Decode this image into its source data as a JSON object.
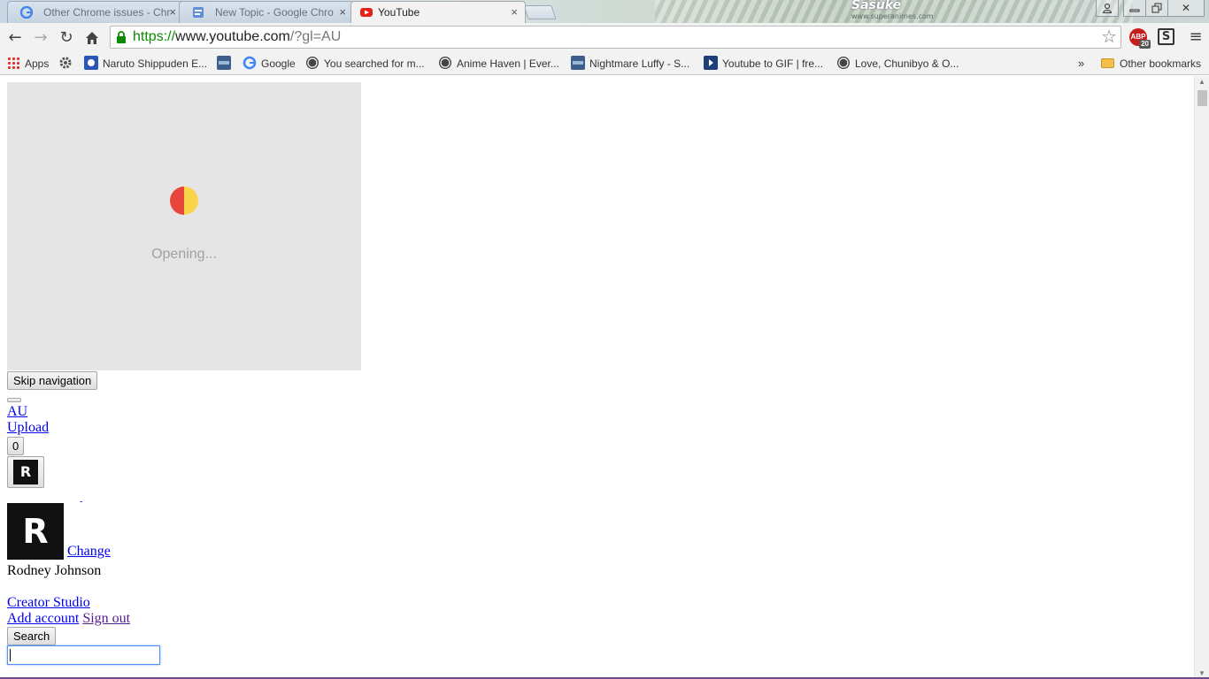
{
  "tabs": [
    {
      "title": "Other Chrome issues - Chr",
      "icon": "google-g-icon",
      "active": false
    },
    {
      "title": "New Topic - Google Chro",
      "icon": "forum-icon",
      "active": false
    },
    {
      "title": "YouTube",
      "icon": "youtube-icon",
      "active": true
    }
  ],
  "tab_close_glyph": "×",
  "window": {
    "brand": "Sasuke",
    "brand_url": "www.superanimes.com",
    "minimize": "▭",
    "restore": "⧉",
    "close": "✕",
    "user": "👤"
  },
  "toolbar": {
    "back": "←",
    "forward": "→",
    "reload": "↻",
    "home": "⌂",
    "url_scheme": "https://",
    "url_host": "www.youtube.com",
    "url_path": "/?gl=AU",
    "star": "☆",
    "abp_label": "ABP",
    "abp_count": "20",
    "ext_s_label": "S",
    "menu": "≡"
  },
  "bookmarks": {
    "apps": "Apps",
    "items": [
      "Naruto Shippuden E...",
      "Google",
      "You searched for m...",
      "Anime Haven | Ever...",
      "Nightmare Luffy - S...",
      "Youtube to GIF | fre...",
      "Love, Chunibyo & O..."
    ],
    "overflow": "»",
    "other": "Other bookmarks"
  },
  "page": {
    "loading_text": "Opening...",
    "skip_navigation": "Skip navigation",
    "region_link": "AU",
    "upload_link": "Upload",
    "notification_count": "0",
    "logo_letter": "R",
    "change_link": "Change",
    "user_name": "Rodney Johnson",
    "creator_studio": "Creator Studio",
    "add_account": "Add account",
    "sign_out": "Sign out",
    "search_button": "Search",
    "search_value": ""
  },
  "colors": {
    "loader_bg": "#e5e5e5",
    "loader_red": "#e8453c",
    "loader_yellow": "#f9d449",
    "link": "#0000ee",
    "visited_link": "#551a8b",
    "url_secure": "#0b8a00"
  }
}
